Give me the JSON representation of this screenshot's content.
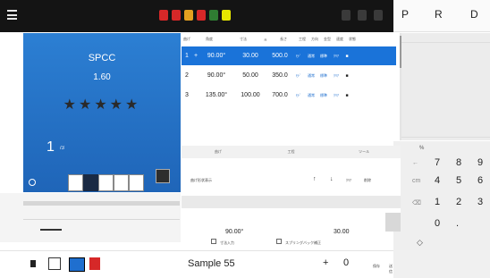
{
  "top_bar": {
    "menu_icon": "hamburger-menu-icon",
    "indicator_colors": [
      "#d62828",
      "#d62828",
      "#e6a020",
      "#d62828",
      "#2f7d32",
      "#e6e600"
    ]
  },
  "right_panel": {
    "letters": [
      "P",
      "R",
      "D"
    ],
    "keypad_label": "%",
    "keys": [
      [
        "←",
        "7",
        "8",
        "9"
      ],
      [
        "cm",
        "4",
        "5",
        "6"
      ],
      [
        "⌫",
        "1",
        "2",
        "3"
      ],
      [
        "",
        "0",
        ".",
        ""
      ]
    ],
    "footer_icon": "diamond-icon"
  },
  "material": {
    "name": "SPCC",
    "thickness": "1.60",
    "stars": "★★★★★",
    "page_current": "1",
    "page_total": "/3",
    "accent_color": "#1f6fcf"
  },
  "table": {
    "headers": [
      "曲げ",
      "角度",
      "寸法",
      "R",
      "長さ",
      "工程",
      "方向",
      "金型",
      "速度",
      "状態"
    ],
    "rows": [
      {
        "no": "1",
        "mark": "+",
        "angle": "90.00°",
        "dim": "30.00",
        "len": "500.0",
        "a": "ﾓﾄﾞ",
        "b": "通常",
        "c": "標準",
        "d": "ｸﾘｱ",
        "e": "■"
      },
      {
        "no": "2",
        "mark": "",
        "angle": "90.00°",
        "dim": "50.00",
        "len": "350.0",
        "a": "ﾓﾄﾞ",
        "b": "通常",
        "c": "標準",
        "d": "ｸﾘｱ",
        "e": "■"
      },
      {
        "no": "3",
        "mark": "",
        "angle": "135.00°",
        "dim": "100.00",
        "len": "700.0",
        "a": "ﾓﾄﾞ",
        "b": "通常",
        "c": "標準",
        "d": "ｸﾘｱ",
        "e": "■"
      }
    ]
  },
  "tabs": [
    "曲げ",
    "工程",
    "ツール"
  ],
  "controls": {
    "row1_left": "曲げ形状表示",
    "row1_right_a": "ｸﾘｱ",
    "row1_right_b": "削除",
    "value_left": "90.00°",
    "value_right": "30.00",
    "check_a": "寸法入力",
    "check_b": "スプリングバック補正"
  },
  "bottom_bar": {
    "name": "Sample 55",
    "plus": "+",
    "count": "0",
    "right_a": "保存",
    "right_b": "送信",
    "left_labels": [
      "ﾌｧｲﾙ",
      "一覧",
      "",
      "描画"
    ]
  }
}
